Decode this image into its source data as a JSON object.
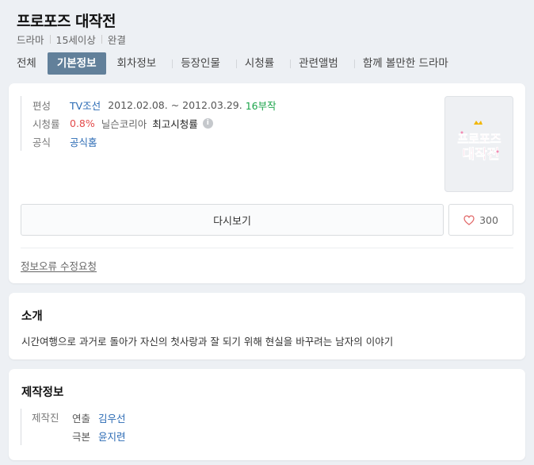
{
  "header": {
    "title": "프로포즈 대작전",
    "meta": [
      "드라마",
      "15세이상",
      "완결"
    ]
  },
  "tabs": [
    {
      "label": "전체",
      "active": false
    },
    {
      "label": "기본정보",
      "active": true
    },
    {
      "label": "회차정보",
      "active": false
    },
    {
      "label": "등장인물",
      "active": false
    },
    {
      "label": "시청률",
      "active": false
    },
    {
      "label": "관련앨범",
      "active": false
    },
    {
      "label": "함께 볼만한 드라마",
      "active": false
    }
  ],
  "info": {
    "broadcast": {
      "label": "편성",
      "channel": "TV조선",
      "period": "2012.02.08. ~ 2012.03.29.",
      "episodes": "16부작"
    },
    "rating": {
      "label": "시청률",
      "value": "0.8%",
      "source": "닐슨코리아",
      "kind": "최고시청률",
      "info_icon": "info-icon"
    },
    "official": {
      "label": "공식",
      "link": "공식홈"
    },
    "poster_text": [
      "프로포즈",
      "대작전"
    ],
    "rewatch_label": "다시보기",
    "like_count": "300",
    "report_label": "정보오류 수정요청"
  },
  "intro": {
    "title": "소개",
    "text": "시간여행으로 과거로 돌아가 자신의 첫사랑과 잘 되기 위해 현실을 바꾸려는 남자의 이야기"
  },
  "production": {
    "title": "제작정보",
    "label": "제작진",
    "rows": [
      {
        "role": "연출",
        "name": "김우선"
      },
      {
        "role": "극본",
        "name": "윤지련"
      }
    ]
  },
  "colors": {
    "background": "#edf0f4",
    "tab_active": "#62809a",
    "link": "#2a6ab4",
    "episodes_green": "#1ba44a",
    "rating_red": "#e34a4a",
    "poster_pink": "#e0336f"
  }
}
